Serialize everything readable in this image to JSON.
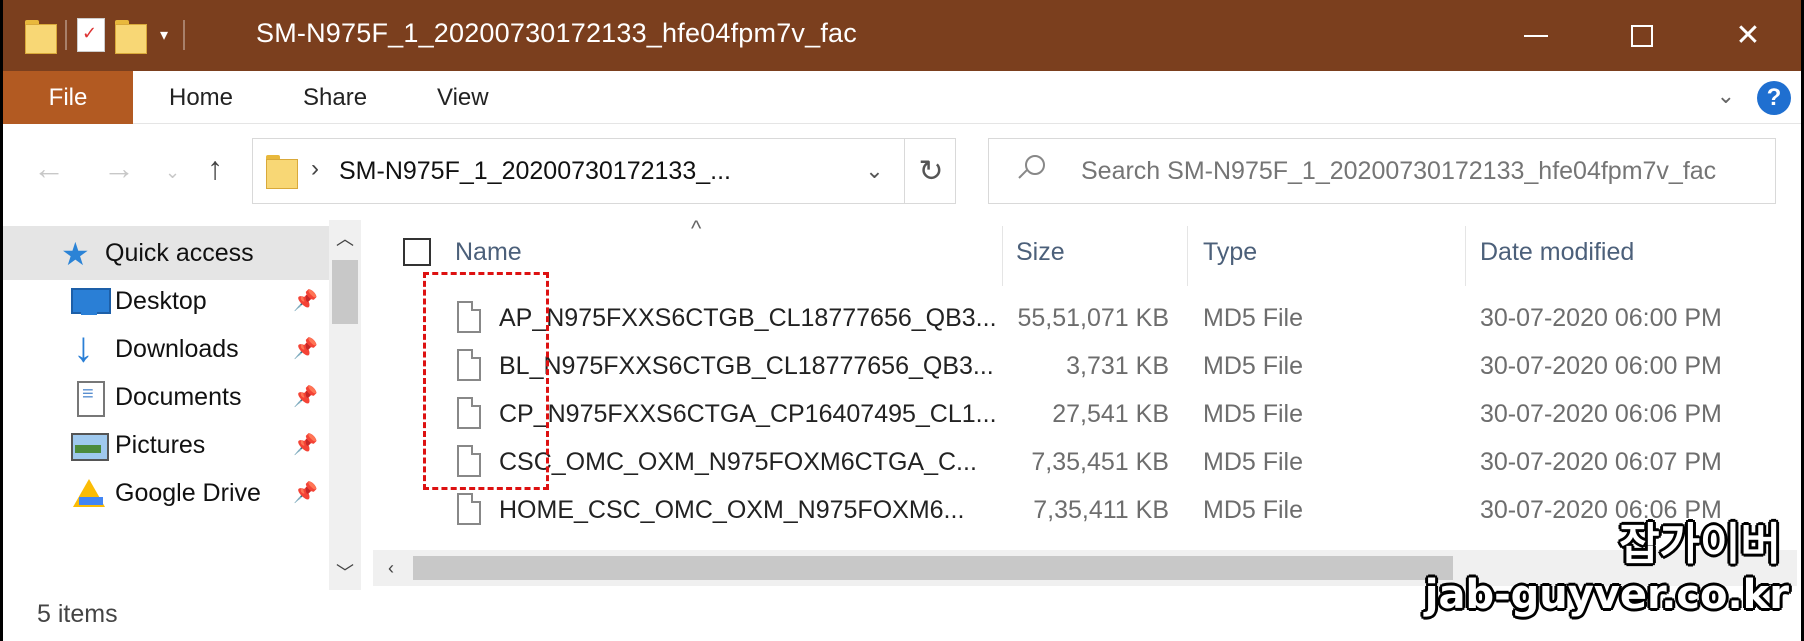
{
  "window": {
    "title": "SM-N975F_1_20200730172133_hfe04fpm7v_fac",
    "title_bar_color": "#7b3f1e"
  },
  "ribbon": {
    "tabs": [
      "File",
      "Home",
      "Share",
      "View"
    ],
    "file_tab_color": "#b25a22",
    "help_label": "?"
  },
  "address": {
    "path": "SM-N975F_1_20200730172133_...",
    "search_placeholder": "Search SM-N975F_1_20200730172133_hfe04fpm7v_fac"
  },
  "nav_pane": {
    "items": [
      {
        "label": "Quick access",
        "icon": "star-icon"
      },
      {
        "label": "Desktop",
        "icon": "desktop-icon"
      },
      {
        "label": "Downloads",
        "icon": "downloads-icon"
      },
      {
        "label": "Documents",
        "icon": "documents-icon"
      },
      {
        "label": "Pictures",
        "icon": "pictures-icon"
      },
      {
        "label": "Google Drive",
        "icon": "google-drive-icon"
      }
    ]
  },
  "file_list": {
    "columns": [
      "Name",
      "Size",
      "Type",
      "Date modified"
    ],
    "rows": [
      {
        "name": "AP_N975FXXS6CTGB_CL18777656_QB3...",
        "size": "55,51,071 KB",
        "type": "MD5 File",
        "date": "30-07-2020 06:00 PM"
      },
      {
        "name": "BL_N975FXXS6CTGB_CL18777656_QB3...",
        "size": "3,731 KB",
        "type": "MD5 File",
        "date": "30-07-2020 06:00 PM"
      },
      {
        "name": "CP_N975FXXS6CTGA_CP16407495_CL1...",
        "size": "27,541 KB",
        "type": "MD5 File",
        "date": "30-07-2020 06:06 PM"
      },
      {
        "name": "CSC_OMC_OXM_N975FOXM6CTGA_C...",
        "size": "7,35,451 KB",
        "type": "MD5 File",
        "date": "30-07-2020 06:07 PM"
      },
      {
        "name": "HOME_CSC_OMC_OXM_N975FOXM6...",
        "size": "7,35,411 KB",
        "type": "MD5 File",
        "date": "30-07-2020 06:06 PM"
      }
    ]
  },
  "status": {
    "item_count": "5 items"
  },
  "watermark": {
    "korean": "잡가이버",
    "url": "jab-guyver.co.kr"
  }
}
